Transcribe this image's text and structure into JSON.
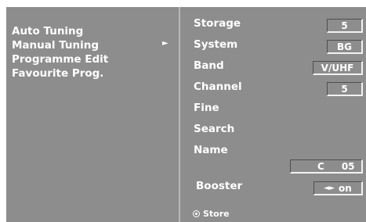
{
  "left_menu": {
    "items": [
      {
        "label": "Auto Tuning"
      },
      {
        "label": "Manual Tuning",
        "arrow": "►"
      },
      {
        "label": "Programme Edit"
      },
      {
        "label": "Favourite Prog."
      }
    ]
  },
  "right_menu": {
    "storage_label": "Storage",
    "storage_value": "5",
    "system_label": "System",
    "system_value": "BG",
    "band_label": "Band",
    "band_value": "V/UHF",
    "channel_label": "Channel",
    "channel_value": "5",
    "fine_label": "Fine",
    "search_label": "Search",
    "name_label": "Name",
    "name_value_prefix": "C",
    "name_value_number": "05",
    "booster_label": "Booster",
    "booster_arrows": "◄►",
    "booster_value": "on"
  },
  "footer": {
    "store_label": "Store",
    "store_icon": "circle-dot-icon"
  }
}
